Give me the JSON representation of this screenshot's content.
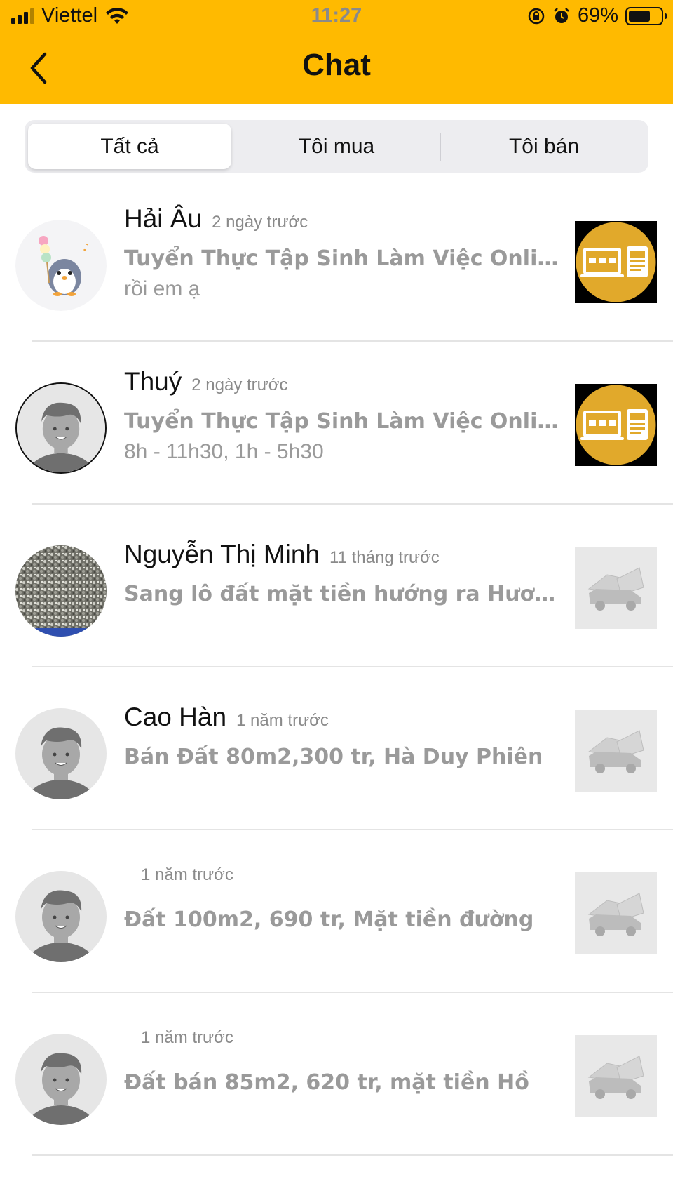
{
  "status_bar": {
    "carrier": "Viettel",
    "time": "11:27",
    "battery": "69%",
    "battery_level": 0.69,
    "icons": [
      "signal-icon",
      "wifi-icon",
      "rotation-lock-icon",
      "alarm-icon",
      "battery-icon"
    ]
  },
  "header": {
    "title": "Chat",
    "back_icon": "chevron-left-icon",
    "background": "#FFBA00"
  },
  "tabs": [
    {
      "label": "Tất cả",
      "active": true
    },
    {
      "label": "Tôi mua",
      "active": false
    },
    {
      "label": "Tôi bán",
      "active": false
    }
  ],
  "conversations": [
    {
      "name": "Hải Âu",
      "time": "2 ngày trước",
      "title": "Tuyển Thực Tập Sinh Làm Việc Online",
      "message": "rồi em ạ",
      "avatar": "penguin-avatar",
      "thumbnail": "web-design-thumbnail"
    },
    {
      "name": "Thuý",
      "time": "2 ngày trước",
      "title": "Tuyển Thực Tập Sinh Làm Việc Online",
      "message": "8h - 11h30, 1h - 5h30",
      "avatar": "default-user-avatar",
      "thumbnail": "web-design-thumbnail"
    },
    {
      "name": "Nguyễn Thị Minh",
      "time": "11 tháng trước",
      "title": "Sang lô đất mặt tiền hướng ra Hương Lộ",
      "message": "",
      "avatar": "gravel-photo-avatar",
      "thumbnail": "placeholder-house-car-thumbnail"
    },
    {
      "name": "Cao Hàn",
      "time": "1 năm trước",
      "title": "Bán Đất 80m2,300 tr, Hà Duy Phiên",
      "message": "",
      "avatar": "default-user-avatar",
      "thumbnail": "placeholder-house-car-thumbnail"
    },
    {
      "name": "",
      "time": "1 năm trước",
      "title": "Đất 100m2, 690 tr, Mặt tiền đường",
      "message": "",
      "avatar": "default-user-avatar",
      "thumbnail": "placeholder-house-car-thumbnail"
    },
    {
      "name": "",
      "time": "1 năm trước",
      "title": "Đất bán 85m2, 620 tr, mặt tiền Hồ",
      "message": "",
      "avatar": "default-user-avatar",
      "thumbnail": "placeholder-house-car-thumbnail"
    }
  ]
}
